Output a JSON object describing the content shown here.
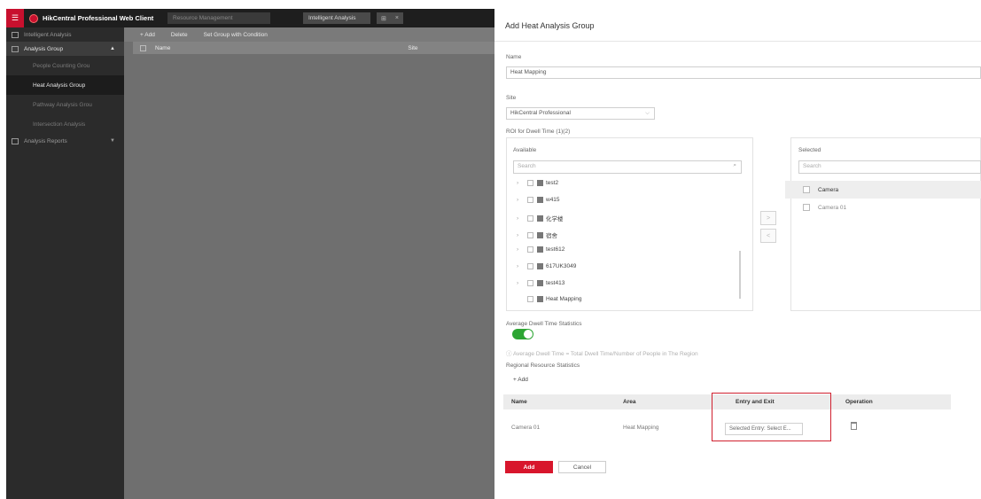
{
  "app": {
    "title": "HikCentral Professional Web Client",
    "top_search_placeholder": "Resource Management",
    "top_dropdown": "Intelligent Analysis",
    "menu_icon": "menu-icon",
    "brand_color": "#c8102e"
  },
  "sidebar": {
    "sections": [
      {
        "label": "Intelligent Analysis",
        "icon": "analysis-icon"
      },
      {
        "label": "Analysis Group",
        "icon": "group-icon"
      }
    ],
    "items": [
      {
        "label": "People Counting Grou"
      },
      {
        "label": "Heat Analysis Group"
      },
      {
        "label": "Pathway Analysis Grou"
      },
      {
        "label": "Intersection Analysis"
      }
    ],
    "bottom_section": {
      "label": "Analysis Reports",
      "icon": "report-icon"
    }
  },
  "content": {
    "toolbar": {
      "add": "+ Add",
      "delete": "Delete",
      "set_group": "Set Group with Condition"
    },
    "table_headers": {
      "name": "Name",
      "site": "Site"
    }
  },
  "panel": {
    "title": "Add Heat Analysis Group",
    "name_label": "Name",
    "name_value": "Heat Mapping",
    "site_label": "Site",
    "site_value": "HikCentral Professional",
    "roi_label": "ROI for Dwell Time (1)(2)",
    "available": {
      "title": "Available",
      "search_placeholder": "Search",
      "tree": [
        "test2",
        "w415",
        "化学楼",
        "宿舍",
        "test612",
        "617UK3049",
        "test413",
        "Heat Mapping"
      ]
    },
    "selected": {
      "title": "Selected",
      "search_placeholder": "Search",
      "items": [
        "Camera",
        "Camera 01"
      ]
    },
    "move_buttons": {
      "right": ">",
      "left": "<"
    },
    "avg_dwell_label": "Average Dwell Time Statistics",
    "avg_dwell_enabled": true,
    "avg_dwell_hint": "Average Dwell Time = Total Dwell Time/Number of People in The Region",
    "regional_label": "Regional Resource Statistics",
    "regional_add": "+ Add",
    "table": {
      "headers": {
        "name": "Name",
        "area": "Area",
        "entry_exit": "Entry and Exit",
        "operation": "Operation"
      },
      "rows": [
        {
          "name": "Camera 01",
          "area": "Heat Mapping",
          "entry_exit": "Selected Entry: Select E..."
        }
      ]
    },
    "add_button": "Add",
    "cancel_button": "Cancel",
    "accent_color": "#d8162c",
    "toggle_color": "#2da533"
  }
}
